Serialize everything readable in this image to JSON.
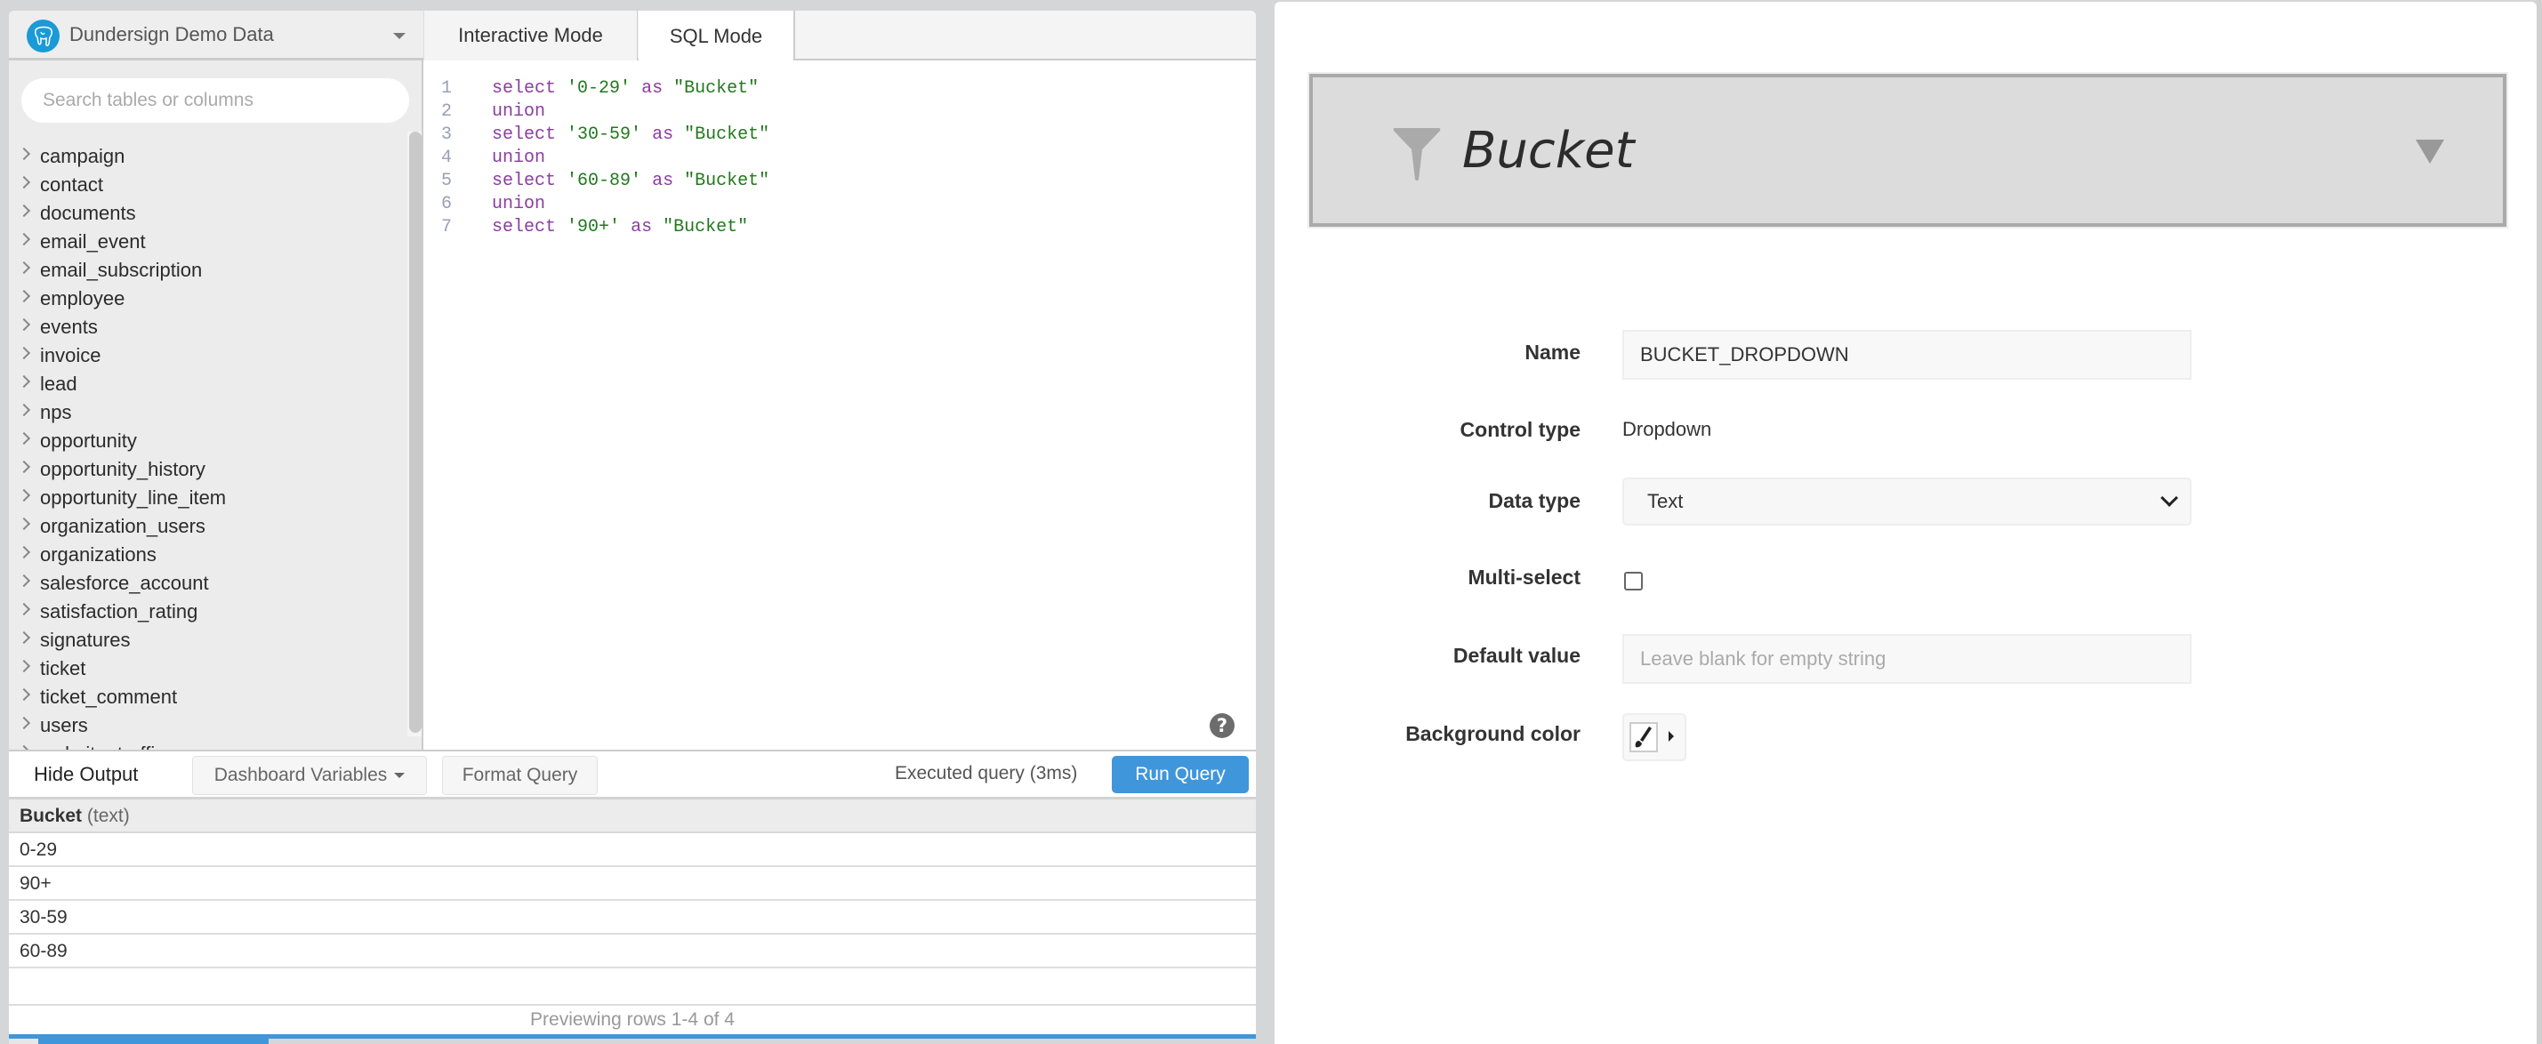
{
  "datasource": {
    "name": "Dundersign Demo Data",
    "icon": "postgres-elephant-icon",
    "brand_color": "#1a9ad6"
  },
  "sidebar": {
    "search_placeholder": "Search tables or columns",
    "search_value": "",
    "tables": [
      "campaign",
      "contact",
      "documents",
      "email_event",
      "email_subscription",
      "employee",
      "events",
      "invoice",
      "lead",
      "nps",
      "opportunity",
      "opportunity_history",
      "opportunity_line_item",
      "organization_users",
      "organizations",
      "salesforce_account",
      "satisfaction_rating",
      "signatures",
      "ticket",
      "ticket_comment",
      "users",
      "website_traffic"
    ]
  },
  "tabs": {
    "interactive": "Interactive Mode",
    "sql": "SQL Mode",
    "active": "sql"
  },
  "editor": {
    "lines": [
      {
        "n": "1",
        "tokens": [
          {
            "t": "select",
            "c": "kw"
          },
          {
            "t": " "
          },
          {
            "t": "'0-29'",
            "c": "str"
          },
          {
            "t": " "
          },
          {
            "t": "as",
            "c": "kw"
          },
          {
            "t": " "
          },
          {
            "t": "\"Bucket\"",
            "c": "str"
          }
        ]
      },
      {
        "n": "2",
        "tokens": [
          {
            "t": "union",
            "c": "kw"
          }
        ]
      },
      {
        "n": "3",
        "tokens": [
          {
            "t": "select",
            "c": "kw"
          },
          {
            "t": " "
          },
          {
            "t": "'30-59'",
            "c": "str"
          },
          {
            "t": " "
          },
          {
            "t": "as",
            "c": "kw"
          },
          {
            "t": " "
          },
          {
            "t": "\"Bucket\"",
            "c": "str"
          }
        ]
      },
      {
        "n": "4",
        "tokens": [
          {
            "t": "union",
            "c": "kw"
          }
        ]
      },
      {
        "n": "5",
        "tokens": [
          {
            "t": "select",
            "c": "kw"
          },
          {
            "t": " "
          },
          {
            "t": "'60-89'",
            "c": "str"
          },
          {
            "t": " "
          },
          {
            "t": "as",
            "c": "kw"
          },
          {
            "t": " "
          },
          {
            "t": "\"Bucket\"",
            "c": "str"
          }
        ]
      },
      {
        "n": "6",
        "tokens": [
          {
            "t": "union",
            "c": "kw"
          }
        ]
      },
      {
        "n": "7",
        "tokens": [
          {
            "t": "select",
            "c": "kw"
          },
          {
            "t": " "
          },
          {
            "t": "'90+'",
            "c": "str"
          },
          {
            "t": " "
          },
          {
            "t": "as",
            "c": "kw"
          },
          {
            "t": " "
          },
          {
            "t": "\"Bucket\"",
            "c": "str"
          }
        ]
      }
    ],
    "help_icon": "?",
    "colors": {
      "keyword": "#8b3ca3",
      "string": "#21791c",
      "line_number": "#9aa0b5"
    }
  },
  "controls": {
    "hide_output": "Hide Output",
    "dashboard_variables": "Dashboard Variables",
    "format_query": "Format Query",
    "status": "Executed query (3ms)",
    "run_query": "Run Query",
    "accent": "#3f96db"
  },
  "results": {
    "column": {
      "name": "Bucket",
      "type": "(text)"
    },
    "rows": [
      "0-29",
      "90+",
      "30-59",
      "60-89"
    ],
    "footer": "Previewing rows 1-4 of 4"
  },
  "filter": {
    "title": "Bucket",
    "icon": "filter-funnel-icon",
    "form": {
      "name_label": "Name",
      "name_value": "BUCKET_DROPDOWN",
      "control_type_label": "Control type",
      "control_type_value": "Dropdown",
      "data_type_label": "Data type",
      "data_type_value": "Text",
      "multi_select_label": "Multi-select",
      "multi_select_checked": false,
      "default_value_label": "Default value",
      "default_value_placeholder": "Leave blank for empty string",
      "default_value": "",
      "background_color_label": "Background color",
      "background_color_icon": "paintbrush-icon"
    }
  }
}
